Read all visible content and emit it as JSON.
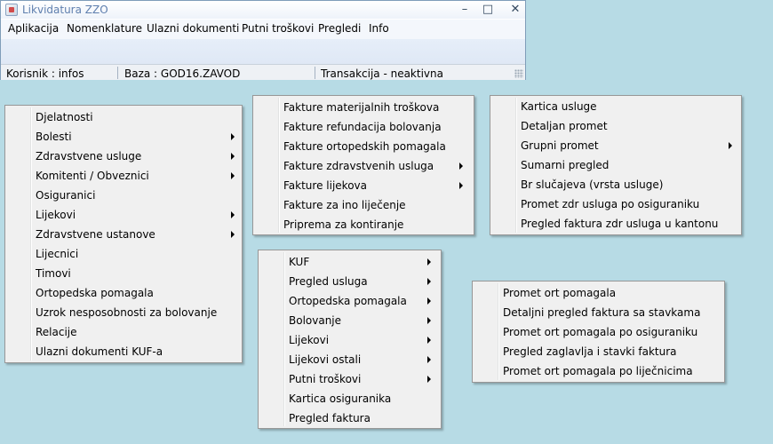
{
  "window": {
    "title": "Likvidatura ZZO",
    "minimize_glyph": "–",
    "maximize_glyph": "□",
    "close_glyph": "✕"
  },
  "menubar": [
    "Aplikacija",
    "Nomenklature",
    "Ulazni dokumenti",
    "Putni troškovi",
    "Pregledi",
    "Info"
  ],
  "statusbar": {
    "user": "Korisnik : infos",
    "database": "Baza : GOD16.ZAVOD",
    "transaction": "Transakcija - neaktivna"
  },
  "menus": {
    "nomenklature": [
      {
        "label": "Djelatnosti",
        "submenu": false
      },
      {
        "label": "Bolesti",
        "submenu": true
      },
      {
        "label": "Zdravstvene usluge",
        "submenu": true
      },
      {
        "label": "Komitenti / Obveznici",
        "submenu": true
      },
      {
        "label": "Osiguranici",
        "submenu": false
      },
      {
        "label": "Lijekovi",
        "submenu": true
      },
      {
        "label": "Zdravstvene ustanove",
        "submenu": true
      },
      {
        "label": "Lijecnici",
        "submenu": false
      },
      {
        "label": "Timovi",
        "submenu": false
      },
      {
        "label": "Ortopedska pomagala",
        "submenu": false
      },
      {
        "label": "Uzrok nesposobnosti za bolovanje",
        "submenu": false
      },
      {
        "label": "Relacije",
        "submenu": false
      },
      {
        "label": "Ulazni dokumenti KUF-a",
        "submenu": false
      }
    ],
    "ulazni_dokumenti": [
      {
        "label": "Fakture materijalnih troškova",
        "submenu": false
      },
      {
        "label": "Fakture refundacija bolovanja",
        "submenu": false
      },
      {
        "label": "Fakture ortopedskih pomagala",
        "submenu": false
      },
      {
        "label": "Fakture zdravstvenih usluga",
        "submenu": true
      },
      {
        "label": "Fakture lijekova",
        "submenu": true
      },
      {
        "label": "Fakture za ino liječenje",
        "submenu": false
      },
      {
        "label": "Priprema za kontiranje",
        "submenu": false
      }
    ],
    "kartica": [
      {
        "label": "Kartica usluge",
        "submenu": false
      },
      {
        "label": "Detaljan promet",
        "submenu": false
      },
      {
        "label": "Grupni promet",
        "submenu": true
      },
      {
        "label": "Sumarni pregled",
        "submenu": false
      },
      {
        "label": "Br slučajeva (vrsta usluge)",
        "submenu": false
      },
      {
        "label": "Promet zdr usluga po osiguraniku",
        "submenu": false
      },
      {
        "label": "Pregled faktura zdr usluga u kantonu",
        "submenu": false
      }
    ],
    "pregledi": [
      {
        "label": "KUF",
        "submenu": true
      },
      {
        "label": "Pregled usluga",
        "submenu": true
      },
      {
        "label": "Ortopedska pomagala",
        "submenu": true
      },
      {
        "label": "Bolovanje",
        "submenu": true
      },
      {
        "label": "Lijekovi",
        "submenu": true
      },
      {
        "label": "Lijekovi ostali",
        "submenu": true
      },
      {
        "label": "Putni troškovi",
        "submenu": true
      },
      {
        "label": "Kartica osiguranika",
        "submenu": false
      },
      {
        "label": "Pregled faktura",
        "submenu": false
      }
    ],
    "ortopedska": [
      {
        "label": "Promet ort pomagala",
        "submenu": false
      },
      {
        "label": "Detaljni pregled faktura sa stavkama",
        "submenu": false
      },
      {
        "label": "Promet ort pomagala po osiguraniku",
        "submenu": false
      },
      {
        "label": "Pregled zaglavlja i stavki faktura",
        "submenu": false
      },
      {
        "label": "Promet ort pomagala po liječnicima",
        "submenu": false
      }
    ]
  }
}
